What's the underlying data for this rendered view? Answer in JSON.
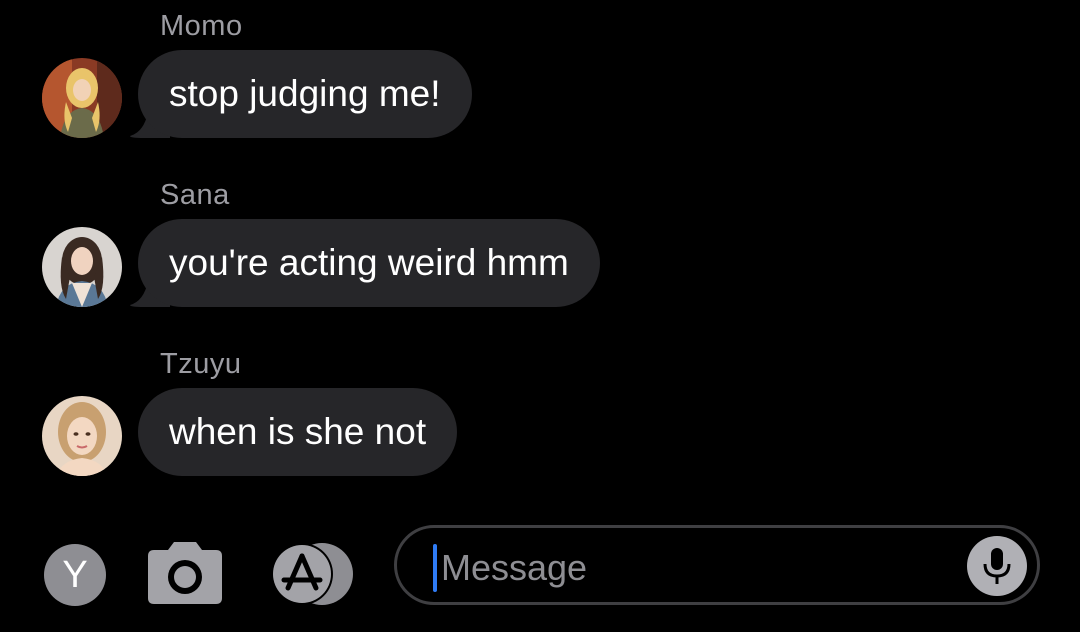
{
  "messages": [
    {
      "sender": "Momo",
      "text": "stop judging me!",
      "avatar_icon": "momo-avatar"
    },
    {
      "sender": "Sana",
      "text": "you're acting weird hmm",
      "avatar_icon": "sana-avatar"
    },
    {
      "sender": "Tzuyu",
      "text": "when is she not",
      "avatar_icon": "tzuyu-avatar"
    }
  ],
  "input_bar": {
    "profile_initial": "Y",
    "camera_icon": "camera-icon",
    "appstore_icon": "app-store-icon",
    "placeholder": "Message",
    "mic_icon": "microphone-icon"
  },
  "colors": {
    "background": "#000000",
    "bubble": "#262629",
    "sender_name": "#9d9da3",
    "cursor": "#2f7cf6",
    "placeholder": "#8e8e93"
  }
}
